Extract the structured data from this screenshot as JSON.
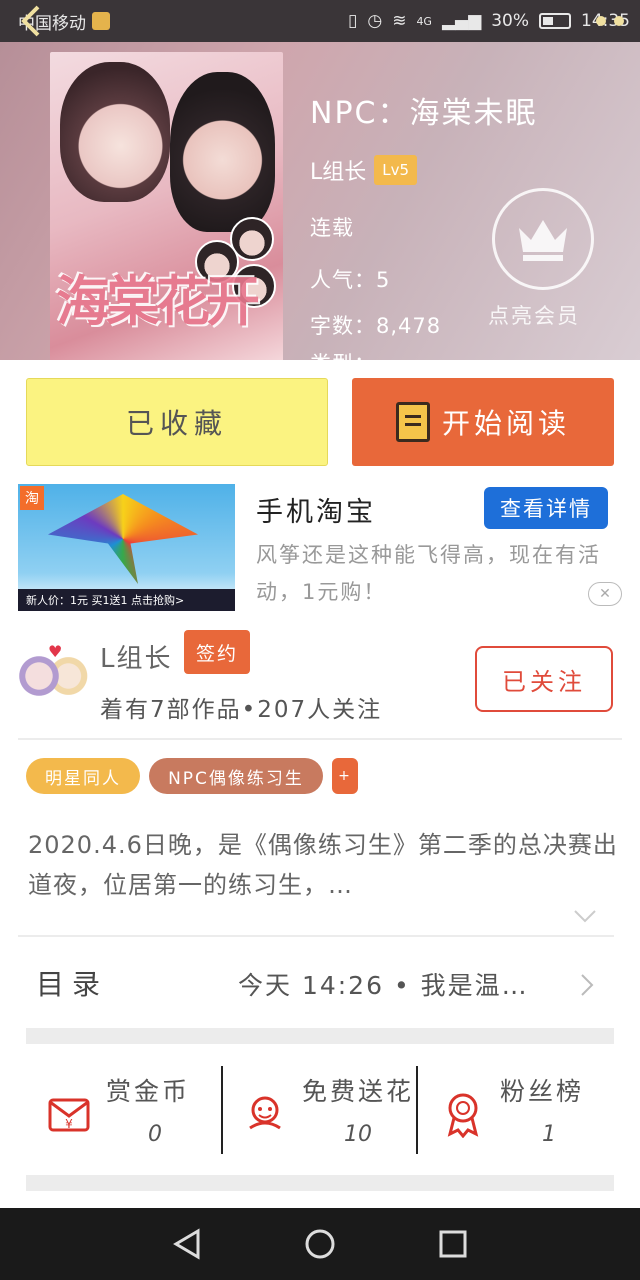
{
  "status_bar": {
    "carrier": "中国移动",
    "network": "4G",
    "battery": "30%",
    "time": "14:35"
  },
  "book": {
    "title": "NPC：海棠未眠",
    "cover_title_art": "海棠花开",
    "author": "L组长",
    "author_level": "Lv5",
    "status": "连载",
    "popularity": "人气：5",
    "word_count": "字数：8,478",
    "truncated_meta": "类型："
  },
  "vip": {
    "label": "点亮会员"
  },
  "actions": {
    "collect_label": "已收藏",
    "read_label": "开始阅读"
  },
  "ad": {
    "badge": "淘",
    "promo_text": "新人价：1元 买1送1 点击抢购>",
    "title": "手机淘宝",
    "detail_button": "查看详情",
    "description": "风筝还是这种能飞得高，现在有活动，1元购！",
    "close": "✕"
  },
  "author_card": {
    "name": "L组长",
    "signed_badge": "签约",
    "stats": "着有7部作品•207人关注",
    "follow_label": "已关注"
  },
  "tags": [
    "明星同人",
    "NPC偶像练习生"
  ],
  "tag_add": "+",
  "summary": "2020.4.6日晚，是《偶像练习生》第二季的总决赛出道夜，位居第一的练习生，…",
  "toc": {
    "label": "目录",
    "latest": "今天 14:26 • 我是温…"
  },
  "stats": [
    {
      "label": "赏金币",
      "value": "0",
      "icon": "reward-coin-icon"
    },
    {
      "label": "免费送花",
      "value": "10",
      "icon": "flower-icon"
    },
    {
      "label": "粉丝榜",
      "value": "1",
      "icon": "medal-icon"
    }
  ],
  "colors": {
    "accent_orange": "#e8683a",
    "collect_yellow": "#fbf381",
    "level_badge": "#f3b94c",
    "taobao_blue": "#1e6fd9",
    "follow_red": "#e04b3b"
  }
}
